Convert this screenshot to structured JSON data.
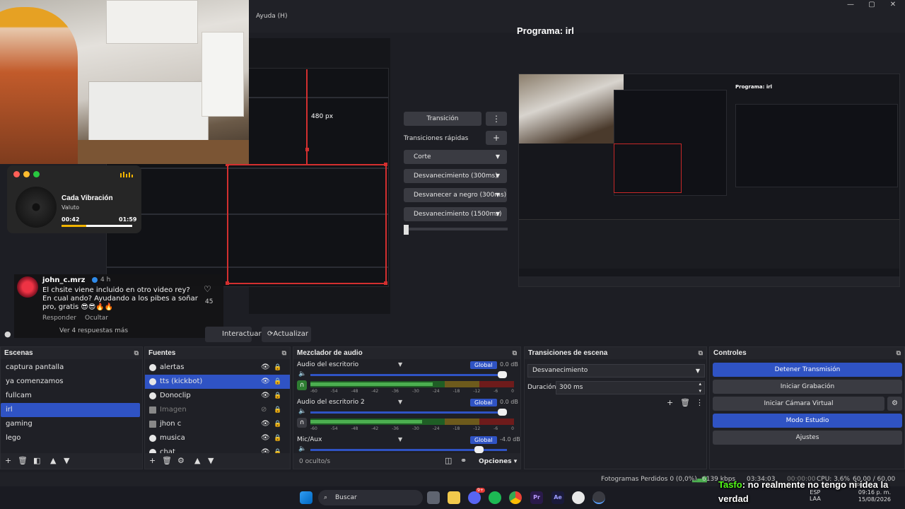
{
  "window": {
    "menu_help": "Ayuda (H)",
    "minimize": "—",
    "maximize": "▢",
    "close": "✕"
  },
  "program": {
    "title": "Programa: irl",
    "inner_title": "Programa: irl"
  },
  "preview": {
    "size_label": "480 px"
  },
  "music": {
    "title": "Cada Vibración",
    "artist": "Valuto",
    "current": "00:42",
    "duration": "01:59",
    "progress": 0.35
  },
  "comment": {
    "user": "john_c.mrz",
    "time": "4 h",
    "text": "El chsite viene incluido en otro video rey? En cual ando? Ayudando a los pibes a soñar pro, gratis 😎😎🔥🔥",
    "likes": "45",
    "reply": "Responder",
    "hide": "Ocultar",
    "more": "Ver 4 respuestas más"
  },
  "transitions_panel": {
    "transition": "Transición",
    "quick": "Transiciones rápidas",
    "options": [
      "Corte",
      "Desvanecimiento (300ms)",
      "Desvanecer a negro (300ms)",
      "Desvanecimiento (1500ms)"
    ]
  },
  "preview_bar": {
    "interact": "Interactuar",
    "update": "Actualizar"
  },
  "scenes": {
    "title": "Escenas",
    "items": [
      "captura pantalla",
      "ya comenzamos",
      "fullcam",
      "irl",
      "gaming",
      "lego"
    ],
    "selected": "irl"
  },
  "sources": {
    "title": "Fuentes",
    "items": [
      {
        "name": "alertas",
        "state": "normal"
      },
      {
        "name": "tts (kickbot)",
        "state": "selected"
      },
      {
        "name": "Donoclip",
        "state": "normal"
      },
      {
        "name": "Imagen",
        "state": "hidden"
      },
      {
        "name": "jhon c",
        "state": "normal"
      },
      {
        "name": "musica",
        "state": "normal"
      },
      {
        "name": "chat",
        "state": "normal"
      }
    ]
  },
  "mixer": {
    "title": "Mezclador de audio",
    "channels": [
      {
        "name": "Audio del escritorio",
        "badge": "Global",
        "db": "0.0 dB",
        "volume": 1.0,
        "level": 0.6
      },
      {
        "name": "Audio del escritorio 2",
        "badge": "Global",
        "db": "0.0 dB",
        "volume": 1.0,
        "level": 0.55
      },
      {
        "name": "Mic/Aux",
        "badge": "Global",
        "db": "-4.0 dB",
        "volume": 0.88,
        "level": 0.0
      }
    ],
    "scale": [
      "-60",
      "-54",
      "-48",
      "-42",
      "-36",
      "-30",
      "-24",
      "-18",
      "-12",
      "-6",
      "0"
    ],
    "hidden": "0 oculto/s",
    "options": "Opciones"
  },
  "scene_transitions": {
    "title": "Transiciones de escena",
    "selected": "Desvanecimiento",
    "duration_label": "Duración",
    "duration": "300 ms"
  },
  "controls": {
    "title": "Controles",
    "stop_stream": "Detener Transmisión",
    "start_recording": "Iniciar Grabación",
    "virtual_cam": "Iniciar Cámara Virtual",
    "studio_mode": "Modo Estudio",
    "settings": "Ajustes"
  },
  "status": {
    "dropped": "Fotogramas Perdidos 0 (0,0%)",
    "kbps": "6139 kbps",
    "stream_time": "03:34:03",
    "rec_time": "00:00:00",
    "cpu": "CPU: 3,6%",
    "fps": "60,00 / 60,00 FPS"
  },
  "taskbar": {
    "search": "Buscar",
    "lang1": "ESP",
    "lang2": "LAA",
    "time": "09:16 p. m.",
    "date": "15/08/2026",
    "discord_badge": "9+"
  },
  "tts": {
    "name": "Tasfo",
    "text": ": no realmente no tengo ni idea la verdad"
  },
  "colors": {
    "accent": "#2f53c4",
    "selection": "#d32f2f",
    "tts_name": "#53fc18"
  }
}
